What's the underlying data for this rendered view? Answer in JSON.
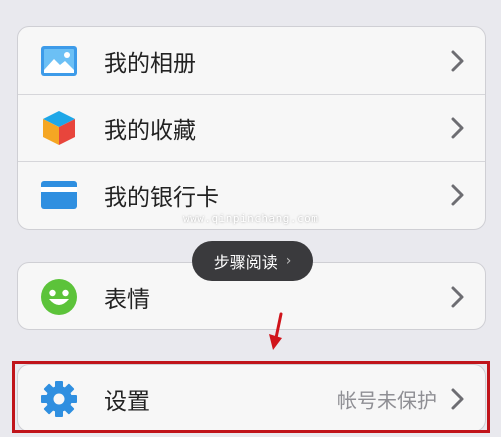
{
  "menu": {
    "group1": [
      {
        "label": "我的相册",
        "icon": "photo-album-icon"
      },
      {
        "label": "我的收藏",
        "icon": "favorites-cube-icon"
      },
      {
        "label": "我的银行卡",
        "icon": "bank-card-icon"
      }
    ],
    "emoticons": {
      "label": "表情",
      "icon": "smiley-icon"
    },
    "settings": {
      "label": "设置",
      "icon": "gear-icon",
      "status": "帐号未保护"
    }
  },
  "watermark": "www.qinpinchang.com",
  "step_reading": {
    "label": "步骤阅读",
    "chevron": "›"
  },
  "colors": {
    "background": "#e9e9ee",
    "row_background": "#f7f7f7",
    "highlight_border": "#c0141a",
    "pill_background": "#3a3a3d"
  }
}
